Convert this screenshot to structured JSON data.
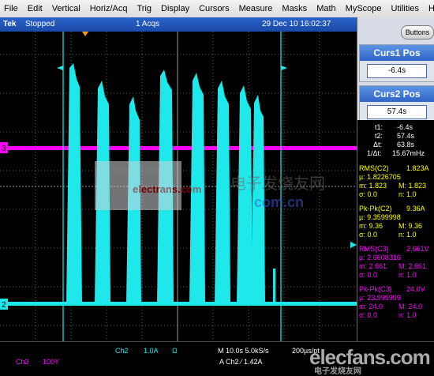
{
  "menu": [
    "File",
    "Edit",
    "Vertical",
    "Horiz/Acq",
    "Trig",
    "Display",
    "Cursors",
    "Measure",
    "Masks",
    "Math",
    "MyScope",
    "Utilities",
    "Help"
  ],
  "status": {
    "brand": "Tek",
    "state": "Stopped",
    "acqs": "1 Acqs",
    "date": "29 Dec 10 16:02:37"
  },
  "side": {
    "buttons_label": "Buttons",
    "curs1_title": "Curs1 Pos",
    "curs1_value": "-6.4s",
    "curs2_title": "Curs2 Pos",
    "curs2_value": "57.4s"
  },
  "cursor_readout": {
    "t1": "t1:",
    "t1v": "-6.4s",
    "t2": "t2:",
    "t2v": "57.4s",
    "dt": "Δt:",
    "dtv": "63.8s",
    "inv": "1/Δt:",
    "invv": "15.67mHz"
  },
  "meas_c2_rms": {
    "title": "RMS(C2)",
    "value": "1.823A",
    "mu": "µ: 1.8226705",
    "m": "m: 1.823",
    "M": "M: 1.823",
    "s": "σ: 0.0",
    "n": "n: 1.0"
  },
  "meas_c2_pk": {
    "title": "Pk-Pk(C2)",
    "value": "9.36A",
    "mu": "µ: 9.3599998",
    "m": "m: 9.36",
    "M": "M: 9.36",
    "s": "σ: 0.0",
    "n": "n: 1.0"
  },
  "meas_c3_rms": {
    "title": "RMS(C3)",
    "value": "2.661V",
    "mu": "µ: 2.6608316",
    "m": "m: 2.661",
    "M": "M: 2.661",
    "s": "σ: 0.0",
    "n": "n: 1.0"
  },
  "meas_c3_pk": {
    "title": "Pk-Pk(C3)",
    "value": "24.0V",
    "mu": "µ: 23.999999",
    "m": "m: 24.0",
    "M": "M: 24.0",
    "s": "σ: 0.0",
    "n": "n: 1.0"
  },
  "markers": {
    "ch3": "3",
    "ch2": "2"
  },
  "bottom": {
    "ch2": "Ch2",
    "ch2_scale": "1.0A",
    "ohm": "Ω",
    "ch3": "Ch3",
    "ch3_scale": "100Y",
    "timebase": "M 10.0s 5.0kS/s",
    "per_pt": "200µs/pt",
    "trigger": "A  Ch2  ⁄  1.42A"
  },
  "watermark": {
    "left": "electrans.com",
    "cn": "电子发烧友网",
    "right": "com.cn",
    "elecfans": "elecfans.com"
  },
  "colors": {
    "ch2": "#1ee8ea",
    "ch3": "#ff00ff",
    "menu_blue": "#1a4aa8",
    "measure_rms": "#ffff00",
    "magenta": "#ff00ff"
  }
}
